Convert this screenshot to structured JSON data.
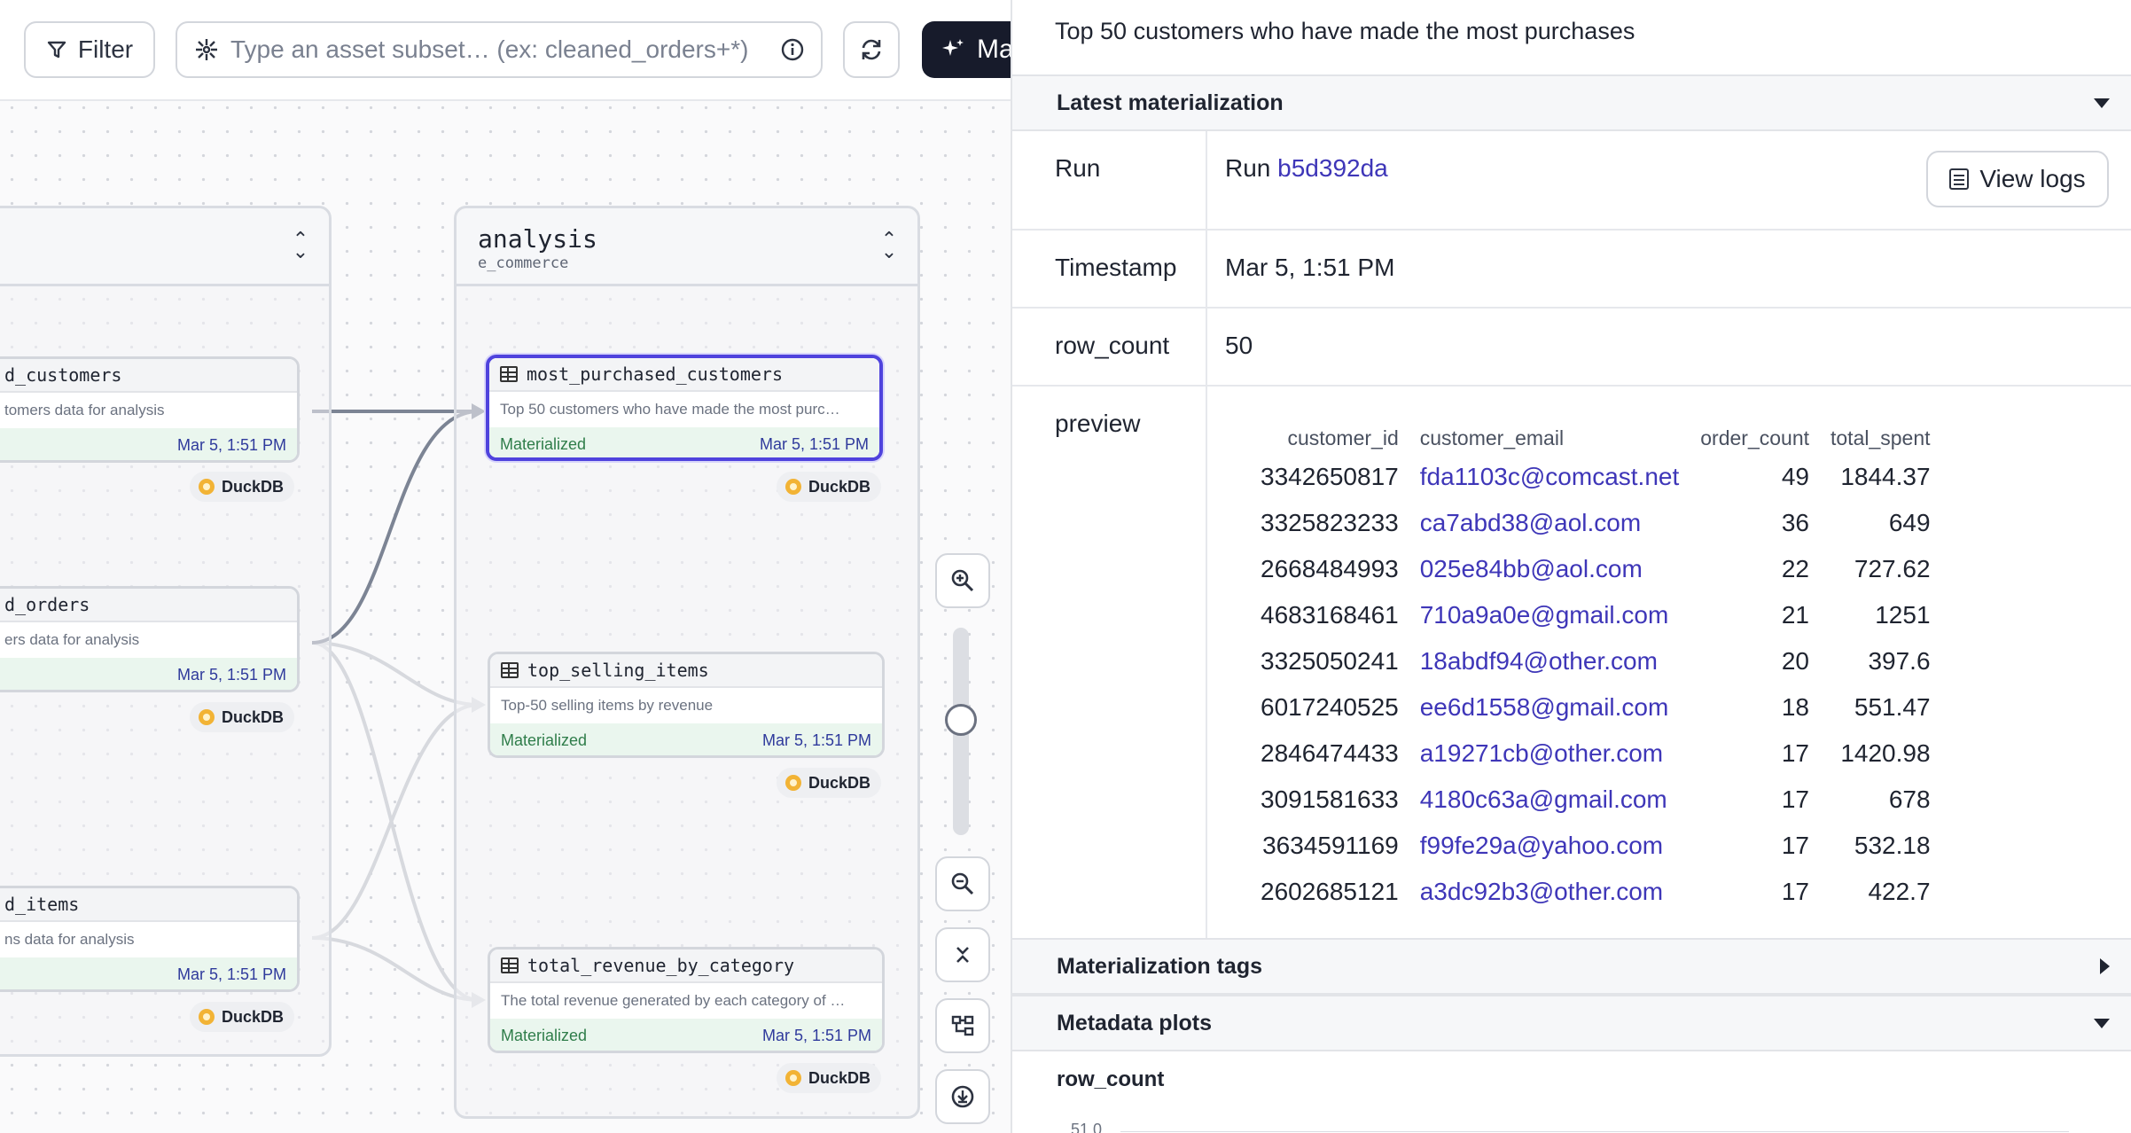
{
  "toolbar": {
    "filter_label": "Filter",
    "search_placeholder": "Type an asset subset… (ex: cleaned_orders+*)",
    "materialize_label": "Mat"
  },
  "groups": {
    "left": {
      "title": ""
    },
    "analysis": {
      "title": "analysis",
      "subtitle": "e_commerce"
    }
  },
  "nodes": {
    "customers": {
      "name": "d_customers",
      "description": "tomers data for analysis",
      "status": "",
      "timestamp": "Mar 5, 1:51 PM",
      "badge": "DuckDB"
    },
    "orders": {
      "name": "d_orders",
      "description": "ers data for analysis",
      "status": "",
      "timestamp": "Mar 5, 1:51 PM",
      "badge": "DuckDB"
    },
    "items": {
      "name": "d_items",
      "description": "ns data for analysis",
      "status": "",
      "timestamp": "Mar 5, 1:51 PM",
      "badge": "DuckDB"
    },
    "most_purchased": {
      "name": "most_purchased_customers",
      "description": "Top 50 customers who have made the most purc…",
      "status": "Materialized",
      "timestamp": "Mar 5, 1:51 PM",
      "badge": "DuckDB"
    },
    "top_selling": {
      "name": "top_selling_items",
      "description": "Top-50 selling items by revenue",
      "status": "Materialized",
      "timestamp": "Mar 5, 1:51 PM",
      "badge": "DuckDB"
    },
    "total_revenue": {
      "name": "total_revenue_by_category",
      "description": "The total revenue generated by each category of …",
      "status": "Materialized",
      "timestamp": "Mar 5, 1:51 PM",
      "badge": "DuckDB"
    }
  },
  "panel": {
    "description": "Top 50 customers who have made the most purchases",
    "latest_materialization": {
      "header": "Latest materialization",
      "run_key": "Run",
      "run_prefix": "Run",
      "run_id": "b5d392da",
      "view_logs_label": "View logs",
      "timestamp_key": "Timestamp",
      "timestamp_value": "Mar 5, 1:51 PM",
      "row_count_key": "row_count",
      "row_count_value": "50",
      "preview_key": "preview"
    },
    "preview": {
      "columns": [
        "customer_id",
        "customer_email",
        "order_count",
        "total_spent"
      ],
      "rows": [
        [
          "3342650817",
          "fda1103c@comcast.net",
          "49",
          "1844.37"
        ],
        [
          "3325823233",
          "ca7abd38@aol.com",
          "36",
          "649"
        ],
        [
          "2668484993",
          "025e84bb@aol.com",
          "22",
          "727.62"
        ],
        [
          "4683168461",
          "710a9a0e@gmail.com",
          "21",
          "1251"
        ],
        [
          "3325050241",
          "18abdf94@other.com",
          "20",
          "397.6"
        ],
        [
          "6017240525",
          "ee6d1558@gmail.com",
          "18",
          "551.47"
        ],
        [
          "2846474433",
          "a19271cb@other.com",
          "17",
          "1420.98"
        ],
        [
          "3091581633",
          "4180c63a@gmail.com",
          "17",
          "678"
        ],
        [
          "3634591169",
          "f99fe29a@yahoo.com",
          "17",
          "532.18"
        ],
        [
          "2602685121",
          "a3dc92b3@other.com",
          "17",
          "422.7"
        ]
      ]
    },
    "materialization_tags_header": "Materialization tags",
    "metadata_plots_header": "Metadata plots",
    "plot_title": "row_count",
    "plot_y_label": "51.0"
  },
  "colors": {
    "accent": "#4f43dd",
    "link": "#3e36b8",
    "materialized_bg": "#eaf6ee",
    "materialized_text": "#2f7d4a",
    "edge_active": "#7c8494",
    "edge_inactive": "#d7d9de"
  },
  "icons": [
    "filter-icon",
    "asset-selection-icon",
    "info-icon",
    "refresh-icon",
    "sparkle-icon",
    "table-icon",
    "duckdb-icon",
    "zoom-in-icon",
    "zoom-out-icon",
    "collapse-all-icon",
    "layout-icon",
    "download-icon",
    "view-logs-icon"
  ]
}
